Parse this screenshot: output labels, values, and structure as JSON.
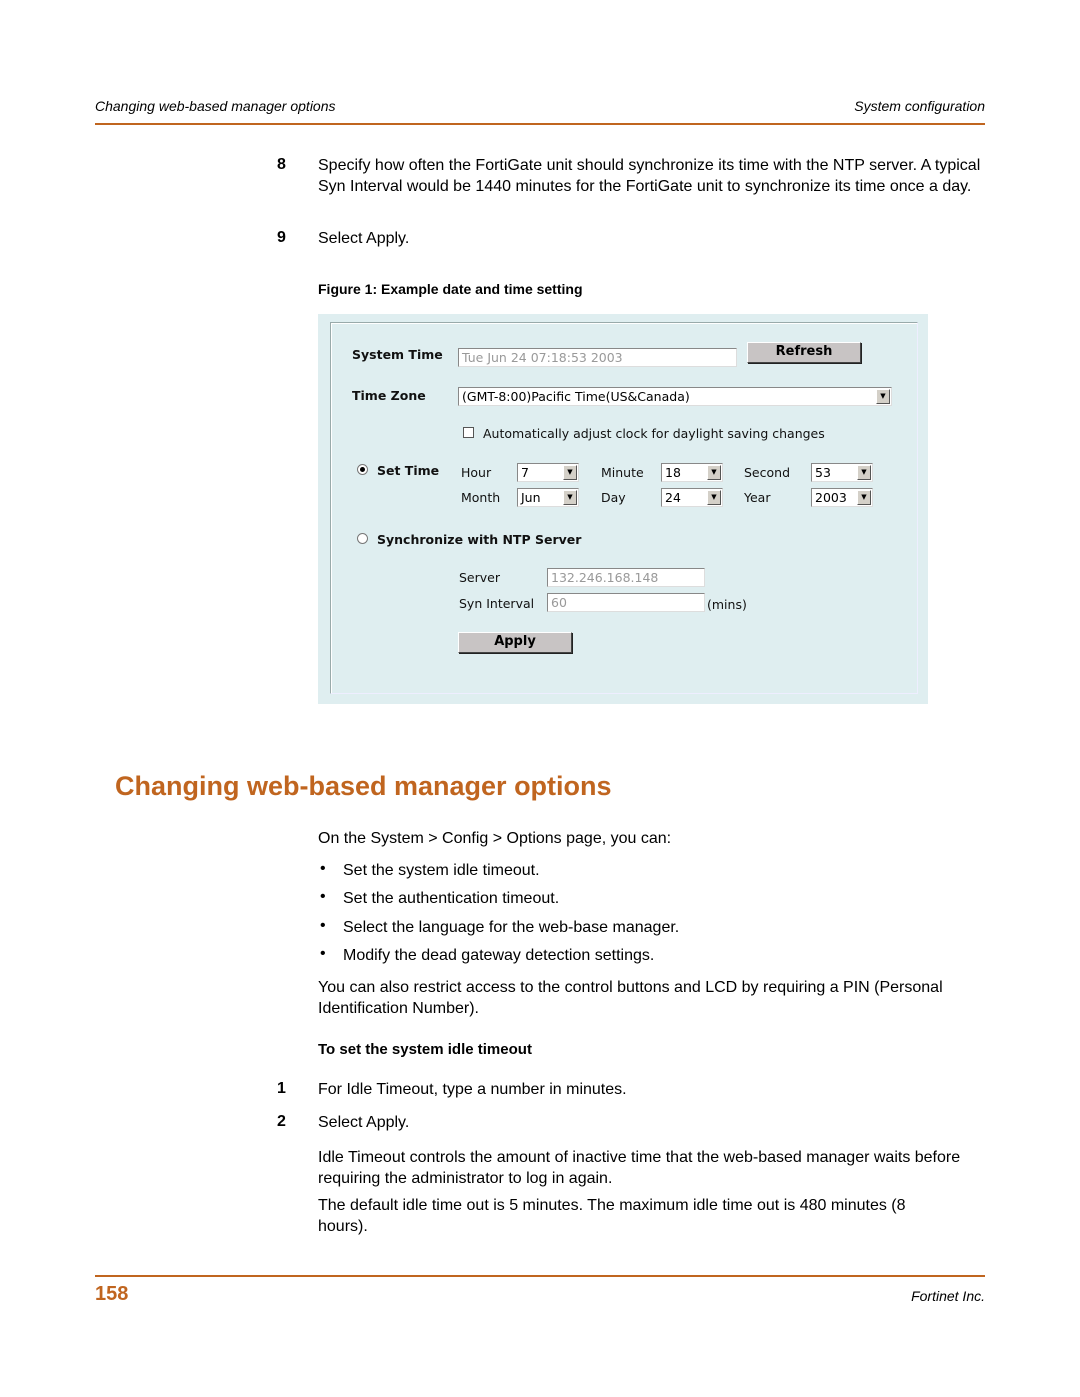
{
  "header": {
    "left": "Changing web-based manager options",
    "right": "System configuration"
  },
  "steps_top": [
    {
      "num": "8",
      "text": "Specify how often the FortiGate unit should synchronize its time with the NTP server. A typical Syn Interval would be 1440 minutes for the FortiGate unit to synchronize its time once a day."
    },
    {
      "num": "9",
      "text": "Select Apply."
    }
  ],
  "figure": {
    "caption": "Figure 1:  Example date and time setting",
    "system_time_label": "System Time",
    "system_time_value": "Tue Jun 24 07:18:53 2003",
    "refresh_label": "Refresh",
    "time_zone_label": "Time Zone",
    "time_zone_value": "(GMT-8:00)Pacific Time(US&Canada)",
    "dst_label": "Automatically adjust clock for daylight saving changes",
    "dst_checked": false,
    "set_time_label": "Set Time",
    "set_time_selected": true,
    "hour_label": "Hour",
    "hour_value": "7",
    "minute_label": "Minute",
    "minute_value": "18",
    "second_label": "Second",
    "second_value": "53",
    "month_label": "Month",
    "month_value": "Jun",
    "day_label": "Day",
    "day_value": "24",
    "year_label": "Year",
    "year_value": "2003",
    "ntp_label": "Synchronize with NTP Server",
    "ntp_selected": false,
    "server_label": "Server",
    "server_value": "132.246.168.148",
    "syn_interval_label": "Syn Interval",
    "syn_interval_value": "60",
    "mins_label": "(mins)",
    "apply_label": "Apply"
  },
  "section": {
    "title": "Changing web-based manager options",
    "intro": "On the System > Config > Options page, you can:",
    "bullets": [
      "Set the system idle timeout.",
      "Set the authentication timeout.",
      "Select the language for the web-base manager.",
      "Modify the dead gateway detection settings."
    ],
    "para_pin": "You can also restrict access to the control buttons and LCD by requiring a PIN (Personal Identification Number).",
    "proc_heading": "To set the system idle timeout",
    "steps": [
      {
        "num": "1",
        "text": "For Idle Timeout, type a number in minutes."
      },
      {
        "num": "2",
        "text": "Select Apply."
      }
    ],
    "para_idle": "Idle Timeout controls the amount of inactive time that the web-based manager waits before requiring the administrator to log in again.",
    "para_default": "The default idle time out is 5 minutes. The maximum idle time out is 480 minutes (8 hours)."
  },
  "footer": {
    "page_number": "158",
    "company": "Fortinet Inc."
  },
  "colors": {
    "accent": "#c0651f",
    "panel_bg": "#dfeef0"
  }
}
